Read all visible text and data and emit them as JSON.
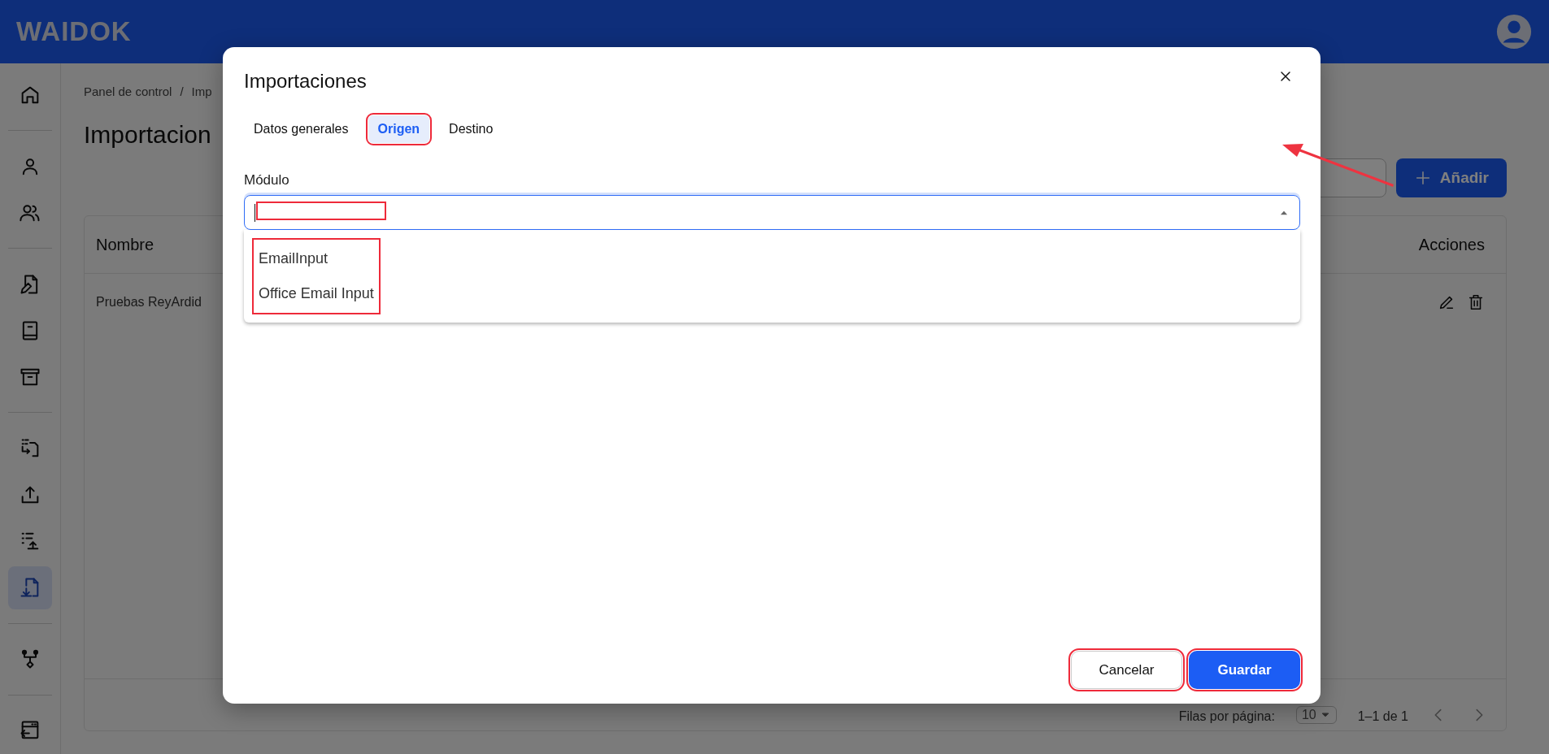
{
  "header": {
    "logo": "WAIDOK"
  },
  "sidebar": {
    "groups": [
      [
        {
          "selected": false
        }
      ],
      [
        {
          "selected": false
        },
        {
          "selected": false
        }
      ],
      [
        {
          "selected": false
        },
        {
          "selected": false
        },
        {
          "selected": false
        }
      ],
      [
        {
          "selected": false
        },
        {
          "selected": false
        },
        {
          "selected": false
        },
        {
          "selected": true
        }
      ],
      [
        {
          "selected": false
        }
      ],
      [
        {
          "selected": false
        }
      ]
    ]
  },
  "breadcrumb": {
    "items": [
      "Panel de control",
      "Imp"
    ],
    "separator": "/"
  },
  "page_title": "Importacion",
  "toolbar": {
    "add_button": "Añadir"
  },
  "table": {
    "columns": [
      "Nombre",
      "Acciones"
    ],
    "rows": [
      {
        "name": "Pruebas ReyArdid"
      }
    ],
    "footer": {
      "rows_per_page_label": "Filas por página:",
      "rows_per_page": "10",
      "range": "1–1 de 1"
    }
  },
  "dialog": {
    "title": "Importaciones",
    "tabs": [
      {
        "label": "Datos generales",
        "selected": false,
        "highlighted": false
      },
      {
        "label": "Origen",
        "selected": true,
        "highlighted": true
      },
      {
        "label": "Destino",
        "selected": false,
        "highlighted": false
      }
    ],
    "field": {
      "label": "Módulo",
      "focused": true,
      "expanded": true,
      "highlighted": true
    },
    "options": [
      {
        "label": "EmailInput"
      },
      {
        "label": "Office Email Input"
      }
    ],
    "options_highlighted": true,
    "buttons": [
      {
        "label": "Cancelar",
        "kind": "secondary",
        "highlighted": true
      },
      {
        "label": "Guardar",
        "kind": "primary",
        "highlighted": true
      }
    ]
  },
  "annotation_arrow": true
}
